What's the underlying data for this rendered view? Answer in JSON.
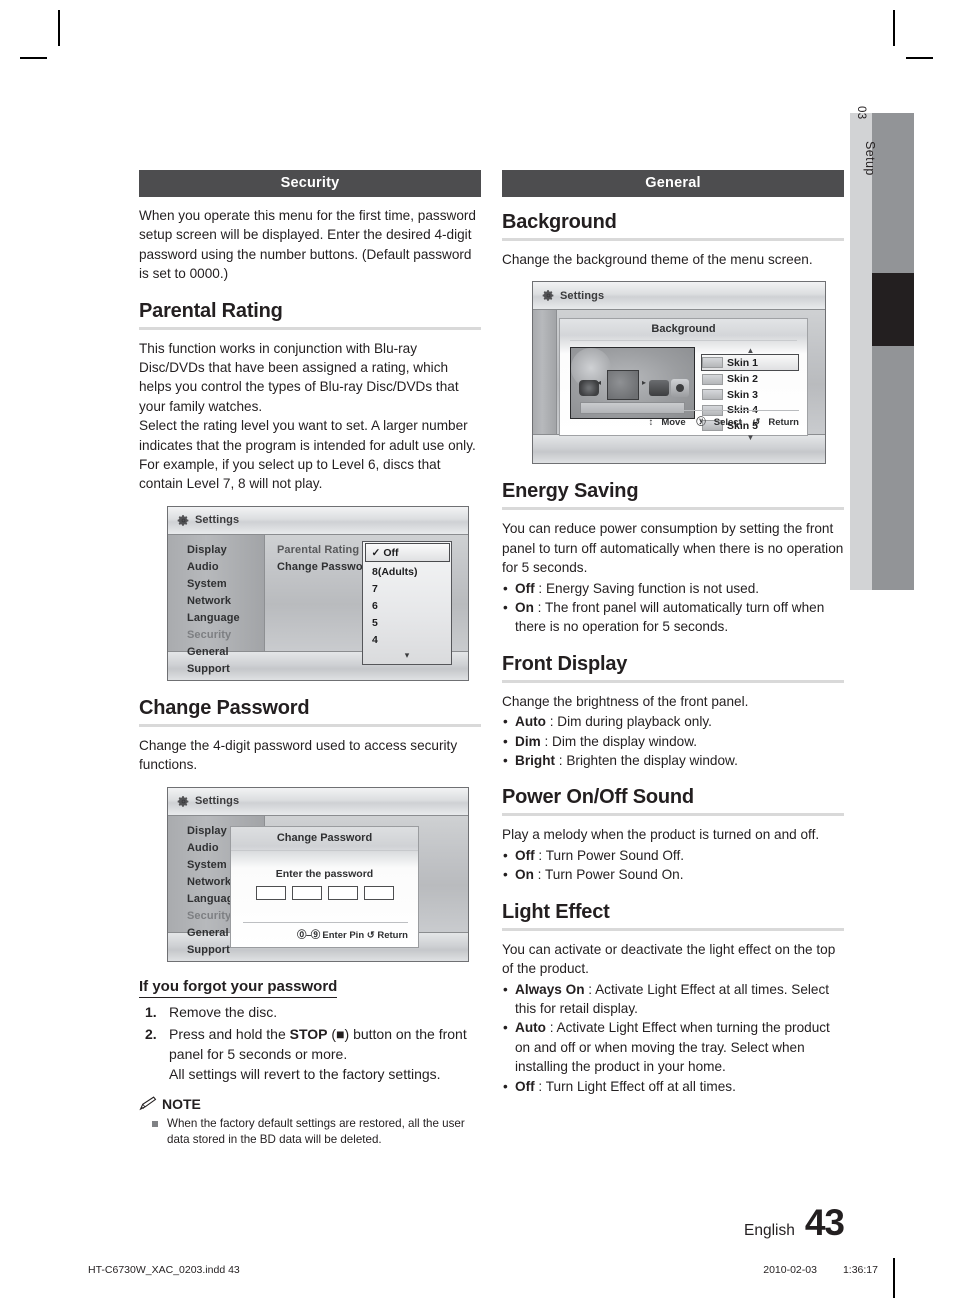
{
  "side_tab": {
    "number": "03",
    "label": "Setup"
  },
  "left_column": {
    "band": "Security",
    "intro": "When you operate this menu for the first time, password setup screen will be displayed. Enter the desired 4-digit password using the number buttons. (Default password is set to 0000.)",
    "parental_rating": {
      "heading": "Parental Rating",
      "paragraph1": "This function works in conjunction with Blu-ray Disc/DVDs that have been assigned a rating, which helps you control the types of Blu-ray Disc/DVDs that your family watches.",
      "paragraph2": "Select the rating level you want to set. A larger number indicates that the program is intended for adult use only. For example, if you select up to Level 6, discs that contain Level 7, 8 will not play.",
      "figure": {
        "window_title": "Settings",
        "menu_items": [
          "Display",
          "Audio",
          "System",
          "Network",
          "Language",
          "Security",
          "General",
          "Support"
        ],
        "menu_selected": "Security",
        "option_labels": [
          "Parental Rating",
          "Change Password"
        ],
        "dropdown_selected": "Off",
        "dropdown_check": "✓",
        "dropdown_items": [
          "8(Adults)",
          "7",
          "6",
          "5",
          "4"
        ],
        "dropdown_more": "▾"
      }
    },
    "change_password": {
      "heading": "Change Password",
      "paragraph": "Change the 4-digit password used to access security functions.",
      "figure": {
        "window_title": "Settings",
        "menu_items": [
          "Display",
          "Audio",
          "System",
          "Network",
          "Language",
          "Security",
          "General",
          "Support"
        ],
        "dialog_title": "Change Password",
        "prompt": "Enter the password",
        "field_count": 4,
        "hint_enter": "Enter Pin",
        "hint_return": "Return",
        "hint_enter_glyph": "⓪–⑨",
        "hint_return_glyph": "↺"
      }
    },
    "forgot": {
      "heading": "If you forgot your password",
      "steps": [
        {
          "num": "1.",
          "text": "Remove the disc."
        },
        {
          "num": "2.",
          "text": "Press and hold the STOP (■) button on the front panel for 5 seconds or more.\nAll settings will revert to the factory settings.",
          "bold_word": "STOP",
          "pre": "Press and hold the ",
          "mid": " (■) button on the front panel for 5 seconds or more.",
          "tail": "All settings will revert to the factory settings."
        }
      ],
      "note_label": "NOTE",
      "notes": [
        "When the factory default settings are restored, all the user data stored in the BD data will be deleted."
      ]
    }
  },
  "right_column": {
    "band": "General",
    "background": {
      "heading": "Background",
      "paragraph": "Change the background theme of the menu screen.",
      "figure": {
        "window_title": "Settings",
        "dialog_title": "Background",
        "skins": [
          "Skin 1",
          "Skin 2",
          "Skin 3",
          "Skin 4",
          "Skin 5"
        ],
        "skin_selected": "Skin 1",
        "up_arrow": "▲",
        "down_arrow": "▼",
        "hint_move": "Move",
        "hint_select": "Select",
        "hint_return": "Return",
        "hint_move_glyph": "↕",
        "hint_select_glyph": "ⓨ",
        "hint_return_glyph": "↺"
      }
    },
    "energy_saving": {
      "heading": "Energy Saving",
      "paragraph": "You can reduce power consumption by setting the front panel to turn off automatically when there is no operation for 5 seconds.",
      "bullets": [
        {
          "term": "Off",
          "desc": " : Energy Saving function is not used."
        },
        {
          "term": "On",
          "desc": " : The front panel will automatically turn off when there is no operation for 5 seconds."
        }
      ]
    },
    "front_display": {
      "heading": "Front Display",
      "paragraph": "Change the brightness of the front panel.",
      "bullets": [
        {
          "term": "Auto",
          "desc": " : Dim during playback only."
        },
        {
          "term": "Dim",
          "desc": " : Dim the display window."
        },
        {
          "term": "Bright",
          "desc": " : Brighten the display window."
        }
      ]
    },
    "power_sound": {
      "heading": "Power On/Off Sound",
      "paragraph": "Play a melody when the product is turned on and off.",
      "bullets": [
        {
          "term": "Off",
          "desc": " : Turn Power Sound Off."
        },
        {
          "term": "On",
          "desc": " : Turn Power Sound On."
        }
      ]
    },
    "light_effect": {
      "heading": "Light Effect",
      "paragraph": "You can activate or deactivate the light effect on the top of the product.",
      "bullets": [
        {
          "term": "Always On",
          "desc": " : Activate Light Effect at all times. Select this for retail display."
        },
        {
          "term": "Auto",
          "desc": " : Activate Light Effect when turning the product on and off or when moving the tray. Select when installing the product in your home."
        },
        {
          "term": "Off",
          "desc": " : Turn Light Effect off at all times."
        }
      ]
    }
  },
  "page_footer": {
    "language": "English",
    "page_number": "43"
  },
  "print_footer": {
    "file": "HT-C6730W_XAC_0203.indd   43",
    "date": "2010-02-03",
    "time": "1:36:17"
  },
  "colors": {
    "band_bg": "#4d4d4f",
    "rule": "#d9d9d9",
    "text": "#231f20",
    "tab_gray": "#929497",
    "tab_light": "#d2d3d5"
  }
}
